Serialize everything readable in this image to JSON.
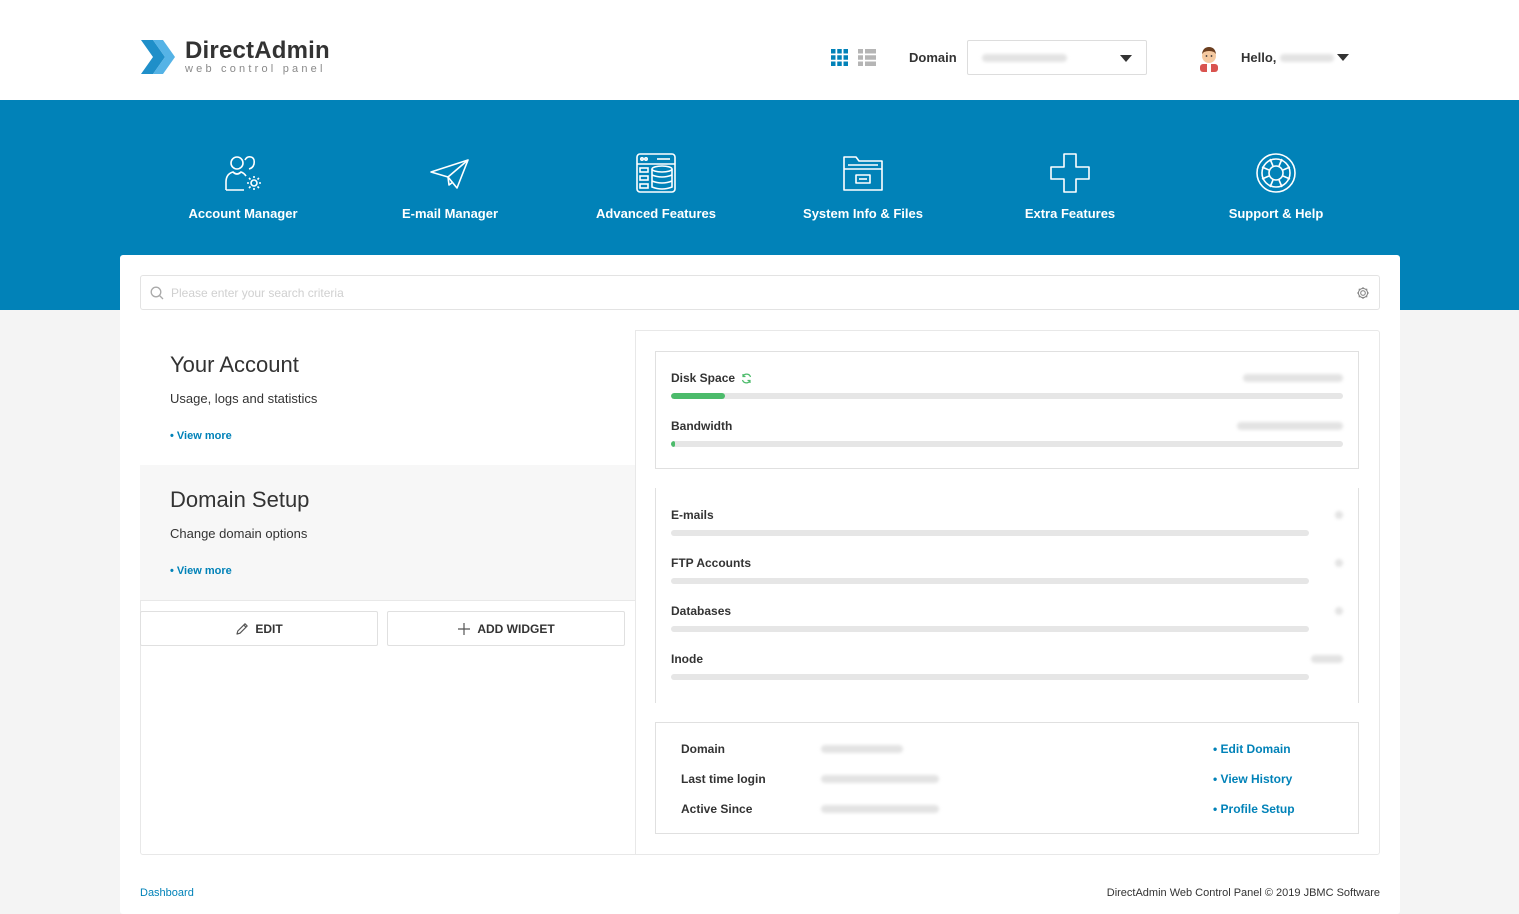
{
  "brand": {
    "title": "DirectAdmin",
    "subtitle": "web control panel",
    "accent": "#0182b8",
    "success": "#4cbb6b"
  },
  "header": {
    "domain_label": "Domain",
    "domain_value": "",
    "hello_label": "Hello,",
    "user_name": ""
  },
  "nav": {
    "items": [
      {
        "label": "Account Manager",
        "icon": "users-gear-icon"
      },
      {
        "label": "E-mail Manager",
        "icon": "paper-plane-icon"
      },
      {
        "label": "Advanced Features",
        "icon": "server-database-icon"
      },
      {
        "label": "System Info & Files",
        "icon": "folder-icon"
      },
      {
        "label": "Extra Features",
        "icon": "plus-icon"
      },
      {
        "label": "Support & Help",
        "icon": "lifebuoy-icon"
      }
    ]
  },
  "search": {
    "placeholder": "Please enter your search criteria"
  },
  "cards": [
    {
      "title": "Your Account",
      "desc": "Usage, logs and statistics",
      "more": "• View more"
    },
    {
      "title": "Domain Setup",
      "desc": "Change domain options",
      "more": "• View more"
    }
  ],
  "buttons": {
    "edit": "EDIT",
    "add_widget": "ADD WIDGET"
  },
  "usage": [
    {
      "label": "Disk Space",
      "fill_pct": 8
    },
    {
      "label": "Bandwidth",
      "fill_pct": 0.5
    }
  ],
  "counts": [
    {
      "label": "E-mails"
    },
    {
      "label": "FTP Accounts"
    },
    {
      "label": "Databases"
    },
    {
      "label": "Inode"
    }
  ],
  "info": [
    {
      "label": "Domain",
      "link": "• Edit Domain"
    },
    {
      "label": "Last time login",
      "link": "• View History"
    },
    {
      "label": "Active Since",
      "link": "• Profile Setup"
    }
  ],
  "footer": {
    "breadcrumb": "Dashboard",
    "copyright": "DirectAdmin Web Control Panel © 2019 JBMC Software"
  }
}
